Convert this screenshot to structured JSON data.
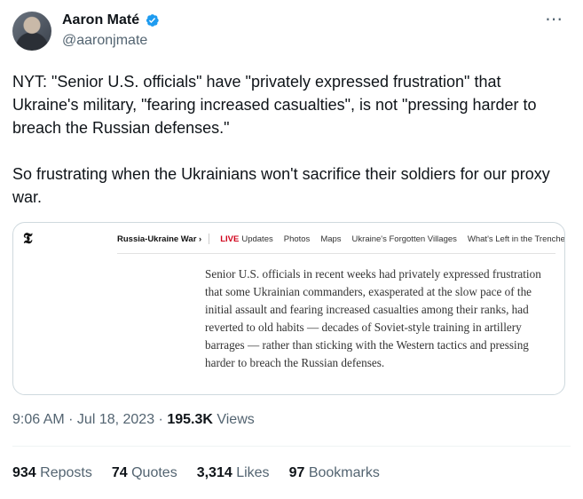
{
  "author": {
    "display_name": "Aaron Maté",
    "handle": "@aaronjmate",
    "verified": true
  },
  "tweet": {
    "text": "NYT: \"Senior U.S. officials\" have \"privately expressed frustration\" that Ukraine's military, \"fearing increased casualties\", is not \"pressing harder to breach the Russian defenses.\"\n\nSo frustrating when the Ukrainians won't sacrifice their soldiers for our proxy war.",
    "more_icon": "⋯"
  },
  "card": {
    "logo": "𝕿",
    "section": "Russia-Ukraine War ›",
    "nav": {
      "live": "LIVE",
      "updates": "Updates",
      "photos": "Photos",
      "maps": "Maps",
      "villages": "Ukraine's Forgotten Villages",
      "trenches": "What's Left in the Trenches"
    },
    "excerpt": "Senior U.S. officials in recent weeks had privately expressed frustration that some Ukrainian commanders, exasperated at the slow pace of the initial assault and fearing increased casualties among their ranks, had reverted to old habits — decades of Soviet-style training in artillery barrages — rather than sticking with the Western tactics and pressing harder to breach the Russian defenses."
  },
  "meta": {
    "timestamp": "9:06 AM · Jul 18, 2023 · ",
    "views_count": "195.3K",
    "views_label": " Views"
  },
  "stats": {
    "reposts": {
      "count": "934",
      "label": "Reposts"
    },
    "quotes": {
      "count": "74",
      "label": "Quotes"
    },
    "likes": {
      "count": "3,314",
      "label": "Likes"
    },
    "bookmarks": {
      "count": "97",
      "label": "Bookmarks"
    }
  },
  "colors": {
    "verified_blue": "#1d9bf0",
    "secondary_text": "#536471",
    "live_red": "#d0021b"
  }
}
